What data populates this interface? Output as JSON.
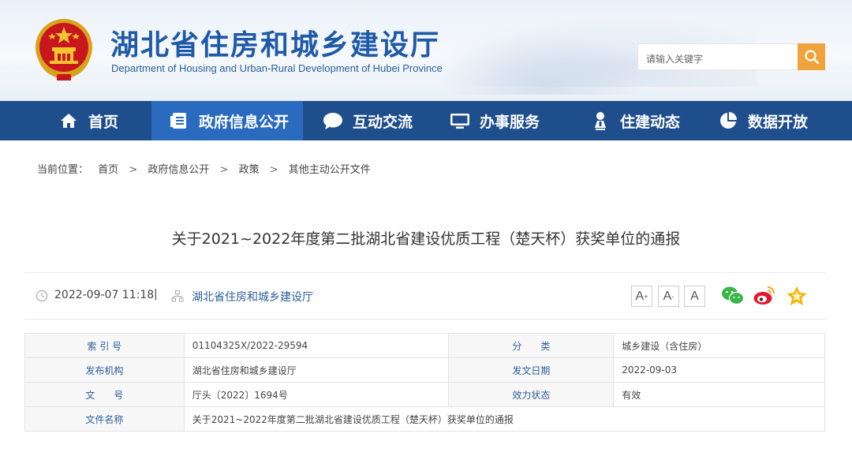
{
  "header": {
    "title": "湖北省住房和城乡建设厅",
    "subtitle": "Department of Housing and Urban-Rural Development of Hubei Province",
    "emblem_icon": "national-emblem-icon"
  },
  "search": {
    "placeholder": "请输入关键字",
    "button_icon": "search-icon"
  },
  "nav": {
    "items": [
      {
        "label": "首页",
        "icon": "home-icon"
      },
      {
        "label": "政府信息公开",
        "icon": "document-list-icon",
        "active": true
      },
      {
        "label": "互动交流",
        "icon": "chat-bubble-icon"
      },
      {
        "label": "办事服务",
        "icon": "monitor-icon"
      },
      {
        "label": "住建动态",
        "icon": "person-pin-icon"
      },
      {
        "label": "数据开放",
        "icon": "pie-chart-icon"
      }
    ]
  },
  "breadcrumb": {
    "prefix": "当前位置：",
    "items": [
      "首页",
      "政府信息公开",
      "政策",
      "其他主动公开文件"
    ],
    "separator": ">"
  },
  "article": {
    "title": "关于2021~2022年度第二批湖北省建设优质工程（楚天杯）获奖单位的通报",
    "datetime": "2022-09-07 11:18",
    "divider": "|",
    "source": "湖北省住房和城乡建设厅"
  },
  "tools": {
    "font_large": "A",
    "font_medium": "A",
    "font_small": "A",
    "share_icons": [
      "wechat-icon",
      "weibo-icon",
      "favorite-star-icon"
    ]
  },
  "info": {
    "index_label": "索 引 号",
    "index_value": "01104325X/2022-29594",
    "category_label": "分　　类",
    "category_value": "城乡建设（含住房）",
    "publisher_label": "发布机构",
    "publisher_value": "湖北省住房和城乡建设厅",
    "issue_date_label": "发文日期",
    "issue_date_value": "2022-09-03",
    "doc_no_label": "文　　号",
    "doc_no_value": "厅头〔2022〕1694号",
    "status_label": "效力状态",
    "status_value": "有效",
    "filename_label": "文件名称",
    "filename_value": "关于2021~2022年度第二批湖北省建设优质工程（楚天杯）获奖单位的通报"
  },
  "colors": {
    "nav_bg": "#1f4e8c",
    "nav_active": "#2a6abf",
    "brand_blue": "#1f5aa8",
    "search_btn": "#f0a33a",
    "wechat": "#3bb54a",
    "weibo": "#e6162d",
    "star": "#f5b400"
  }
}
